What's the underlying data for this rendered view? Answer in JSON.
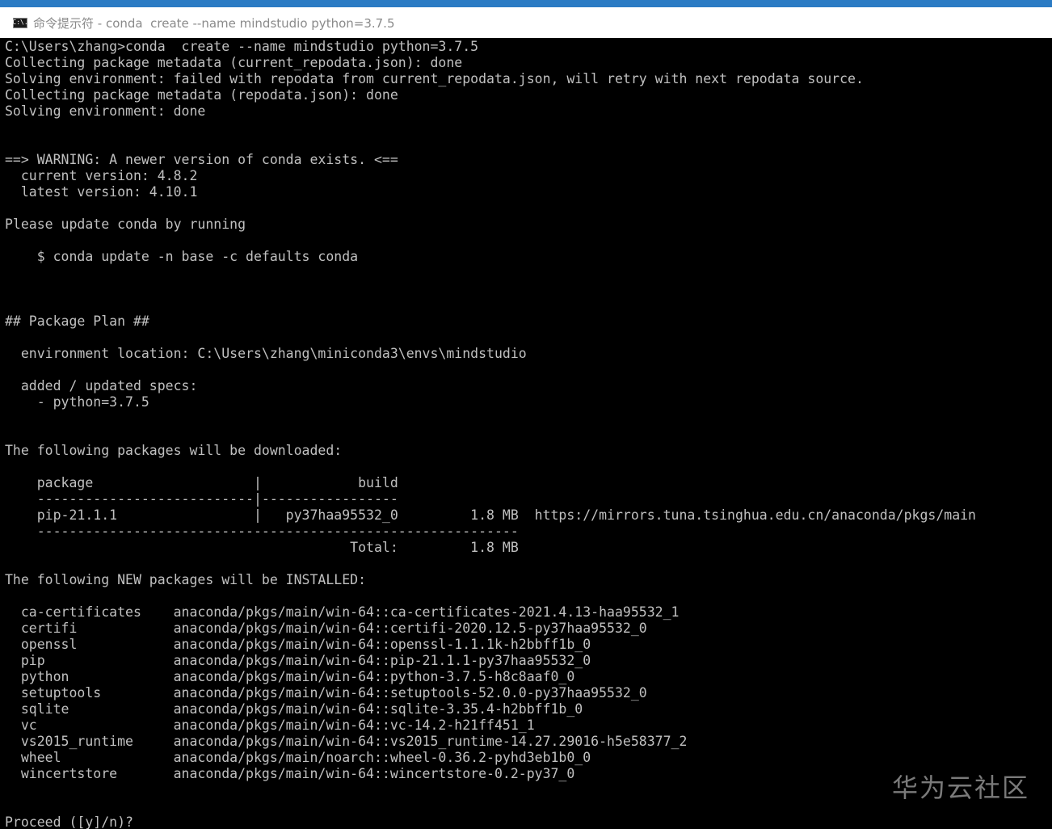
{
  "window": {
    "title": "命令提示符 - conda  create --name mindstudio python=3.7.5",
    "icon": "cmd-icon",
    "icon_text": "C:\\."
  },
  "console": {
    "lines": [
      "C:\\Users\\zhang>conda  create --name mindstudio python=3.7.5",
      "Collecting package metadata (current_repodata.json): done",
      "Solving environment: failed with repodata from current_repodata.json, will retry with next repodata source.",
      "Collecting package metadata (repodata.json): done",
      "Solving environment: done",
      "",
      "",
      "==> WARNING: A newer version of conda exists. <==",
      "  current version: 4.8.2",
      "  latest version: 4.10.1",
      "",
      "Please update conda by running",
      "",
      "    $ conda update -n base -c defaults conda",
      "",
      "",
      "",
      "## Package Plan ##",
      "",
      "  environment location: C:\\Users\\zhang\\miniconda3\\envs\\mindstudio",
      "",
      "  added / updated specs:",
      "    - python=3.7.5",
      "",
      "",
      "The following packages will be downloaded:",
      "",
      "    package                    |            build",
      "    ---------------------------|-----------------",
      "    pip-21.1.1                 |   py37haa95532_0         1.8 MB  https://mirrors.tuna.tsinghua.edu.cn/anaconda/pkgs/main",
      "    ------------------------------------------------------------",
      "                                           Total:         1.8 MB",
      "",
      "The following NEW packages will be INSTALLED:",
      "",
      "  ca-certificates    anaconda/pkgs/main/win-64::ca-certificates-2021.4.13-haa95532_1",
      "  certifi            anaconda/pkgs/main/win-64::certifi-2020.12.5-py37haa95532_0",
      "  openssl            anaconda/pkgs/main/win-64::openssl-1.1.1k-h2bbff1b_0",
      "  pip                anaconda/pkgs/main/win-64::pip-21.1.1-py37haa95532_0",
      "  python             anaconda/pkgs/main/win-64::python-3.7.5-h8c8aaf0_0",
      "  setuptools         anaconda/pkgs/main/win-64::setuptools-52.0.0-py37haa95532_0",
      "  sqlite             anaconda/pkgs/main/win-64::sqlite-3.35.4-h2bbff1b_0",
      "  vc                 anaconda/pkgs/main/win-64::vc-14.2-h21ff451_1",
      "  vs2015_runtime     anaconda/pkgs/main/win-64::vs2015_runtime-14.27.29016-h5e58377_2",
      "  wheel              anaconda/pkgs/main/noarch::wheel-0.36.2-pyhd3eb1b0_0",
      "  wincertstore       anaconda/pkgs/main/win-64::wincertstore-0.2-py37_0",
      "",
      "",
      "Proceed ([y]/n)?"
    ]
  },
  "watermark": {
    "text": "华为云社区"
  },
  "colors": {
    "background": "#000000",
    "text": "#c0c0c0",
    "titlebar_accent": "#2b7bc4"
  }
}
